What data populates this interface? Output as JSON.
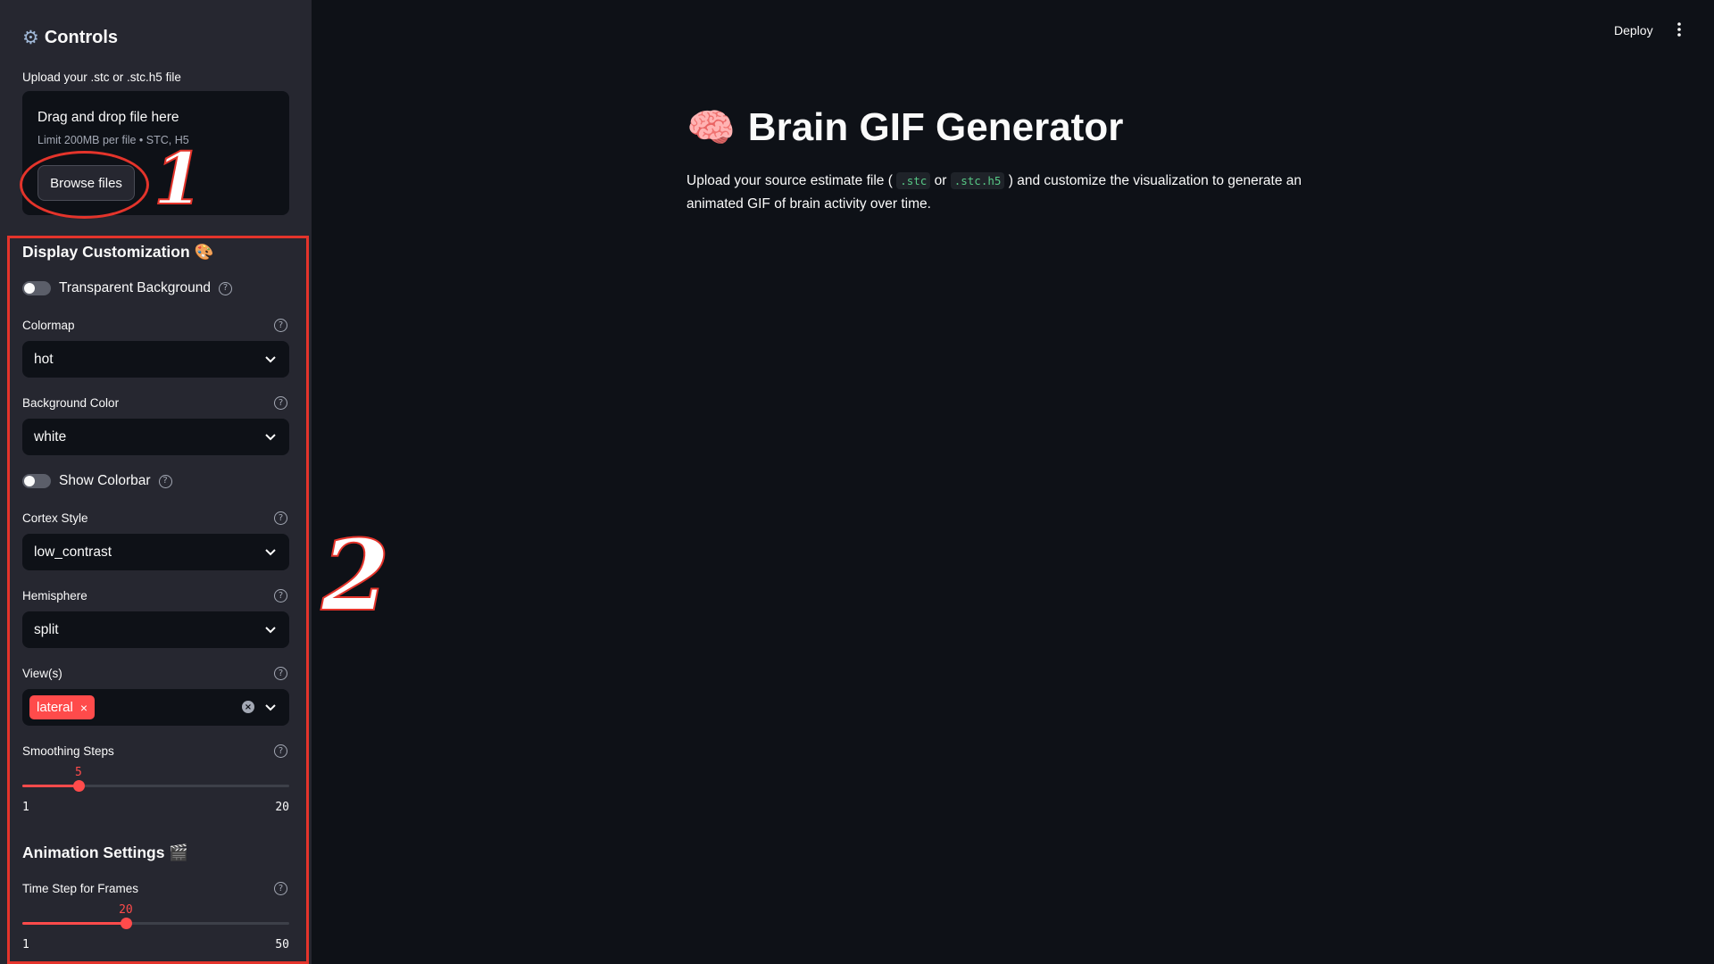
{
  "sidebar": {
    "title": "Controls",
    "upload": {
      "label": "Upload your .stc or .stc.h5 file",
      "drop_text": "Drag and drop file here",
      "limit_text": "Limit 200MB per file • STC, H5",
      "browse_label": "Browse files"
    },
    "display_section": {
      "title": "Display Customization 🎨",
      "transparent_bg_label": "Transparent Background",
      "transparent_bg_on": false,
      "colormap_label": "Colormap",
      "colormap_value": "hot",
      "bg_color_label": "Background Color",
      "bg_color_value": "white",
      "colorbar_label": "Show Colorbar",
      "colorbar_on": false,
      "cortex_label": "Cortex Style",
      "cortex_value": "low_contrast",
      "hemisphere_label": "Hemisphere",
      "hemisphere_value": "split",
      "views_label": "View(s)",
      "views_tags": [
        "lateral"
      ],
      "smoothing_label": "Smoothing Steps",
      "smoothing": {
        "value": 5,
        "min": 1,
        "max": 20,
        "value_text": "5",
        "min_text": "1",
        "max_text": "20"
      }
    },
    "animation_section": {
      "title": "Animation Settings 🎬",
      "timestep_label": "Time Step for Frames",
      "timestep": {
        "value": 20,
        "min": 1,
        "max": 50,
        "value_text": "20",
        "min_text": "1",
        "max_text": "50"
      }
    }
  },
  "annotations": {
    "one": "1",
    "two": "2"
  },
  "header": {
    "deploy_label": "Deploy"
  },
  "main": {
    "title": "Brain GIF Generator",
    "desc_part1": "Upload your source estimate file (",
    "code1": ".stc",
    "desc_or": "or",
    "code2": ".stc.h5",
    "desc_part2": ") and customize the visualization to generate an animated GIF of brain activity over time."
  },
  "colors": {
    "accent": "#ff4b4b",
    "sidebar_bg": "#262730",
    "main_bg": "#0e1117",
    "annotation": "#e4342b"
  },
  "icons": [
    "gear-icon",
    "brain-icon",
    "help-icon",
    "chevron-down-icon",
    "clear-icon",
    "menu-dots-icon"
  ]
}
